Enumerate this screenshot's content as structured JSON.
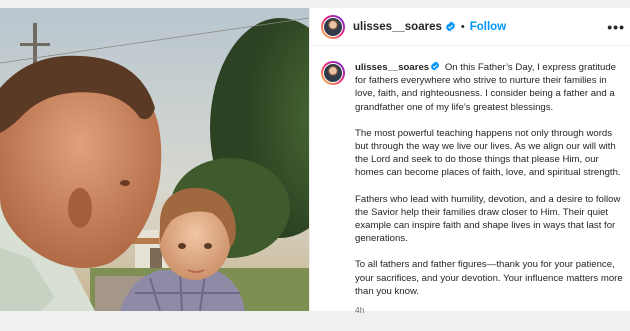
{
  "post": {
    "username": "ulisses__soares",
    "follow_label": "Follow",
    "separator": "•",
    "more_label": "•••",
    "verified_icon": "verified-badge-icon",
    "accent_color": "#0095f6"
  },
  "caption": {
    "username": "ulisses__soares",
    "paragraphs": [
      "On this Father’s Day, I express gratitude for fathers everywhere who strive to nurture their families in love, faith, and righteousness. I consider being a father and a grandfather one of my life’s greatest blessings.",
      "The most powerful teaching happens not only through words but through the way we live our lives. As we align our will with the Lord and seek to do those things that please Him, our homes can become places of faith, love, and spiritual strength.",
      "Fathers who lead with humility, devotion, and a desire to follow the Savior help their families draw closer to Him. Their quiet example can inspire faith and shape lives in ways that last for generations.",
      "To all fathers and father figures—thank you for your patience, your sacrifices, and your devotion. Your influence matters more than you know."
    ],
    "timestamp": "4h"
  }
}
